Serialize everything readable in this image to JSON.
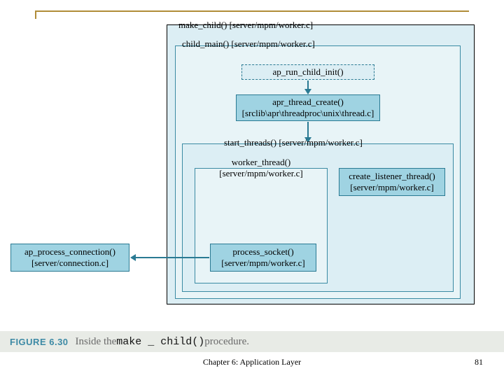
{
  "nodes": {
    "make_child": {
      "label_fn": "make_child()",
      "label_src": "[server/mpm/worker.c]"
    },
    "child_main": {
      "label_fn": "child_main()",
      "label_src": "[server/mpm/worker.c]"
    },
    "hook": {
      "label_fn": "ap_run_child_init()"
    },
    "apr_thread": {
      "label_fn": "apr_thread_create()",
      "label_src": "[srclib\\apr\\threadproc\\unix\\thread.c]"
    },
    "start_threads": {
      "label_fn": "start_threads()",
      "label_src": "[server/mpm/worker.c]"
    },
    "worker_thread": {
      "label_fn": "worker_thread()",
      "label_src": "[server/mpm/worker.c]"
    },
    "process_socket": {
      "label_fn": "process_socket()",
      "label_src": "[server/mpm/worker.c]"
    },
    "create_listener": {
      "label_fn": "create_listener_thread()",
      "label_src": "[server/mpm/worker.c]"
    },
    "ap_process": {
      "label_fn": "ap_process_connection()",
      "label_src": "[server/connection.c]"
    }
  },
  "caption": {
    "fig_num": "FIGURE 6.30",
    "prefix": "Inside the ",
    "code": "make _ child()",
    "suffix": " procedure."
  },
  "footer": {
    "chapter": "Chapter 6: Application Layer",
    "page": "81"
  }
}
